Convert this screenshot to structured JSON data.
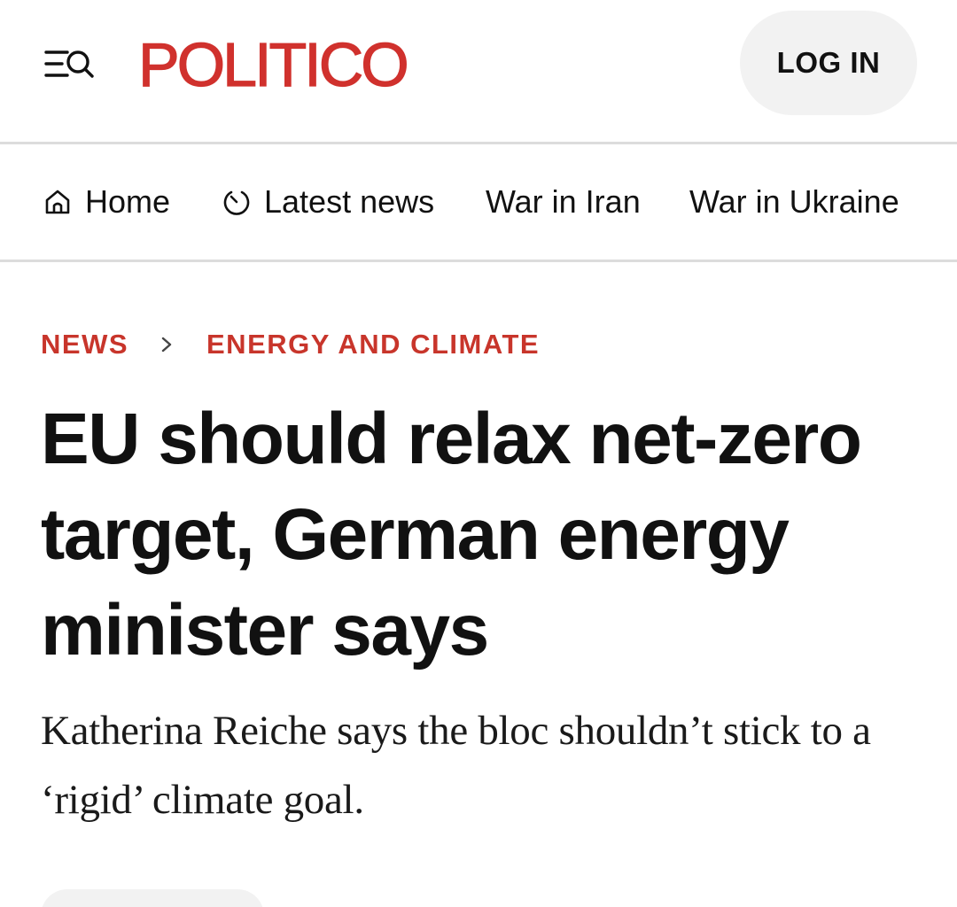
{
  "header": {
    "logo_text": "POLITICO",
    "login_label": "LOG IN",
    "menu_icon": "menu-search-icon",
    "brand_color": "#d0312d"
  },
  "nav": {
    "items": [
      {
        "label": "Home",
        "icon": "home-icon"
      },
      {
        "label": "Latest news",
        "icon": "clock-icon"
      },
      {
        "label": "War in Iran"
      },
      {
        "label": "War in Ukraine"
      }
    ]
  },
  "breadcrumb": {
    "items": [
      "NEWS",
      "ENERGY AND CLIMATE"
    ],
    "separator_icon": "chevron-right-icon",
    "color": "#c8352b"
  },
  "article": {
    "headline": "EU should relax net-zero target, German energy minister says",
    "subhead": "Katherina Reiche says the bloc shouldn’t stick to a ‘rigid’ climate goal."
  }
}
